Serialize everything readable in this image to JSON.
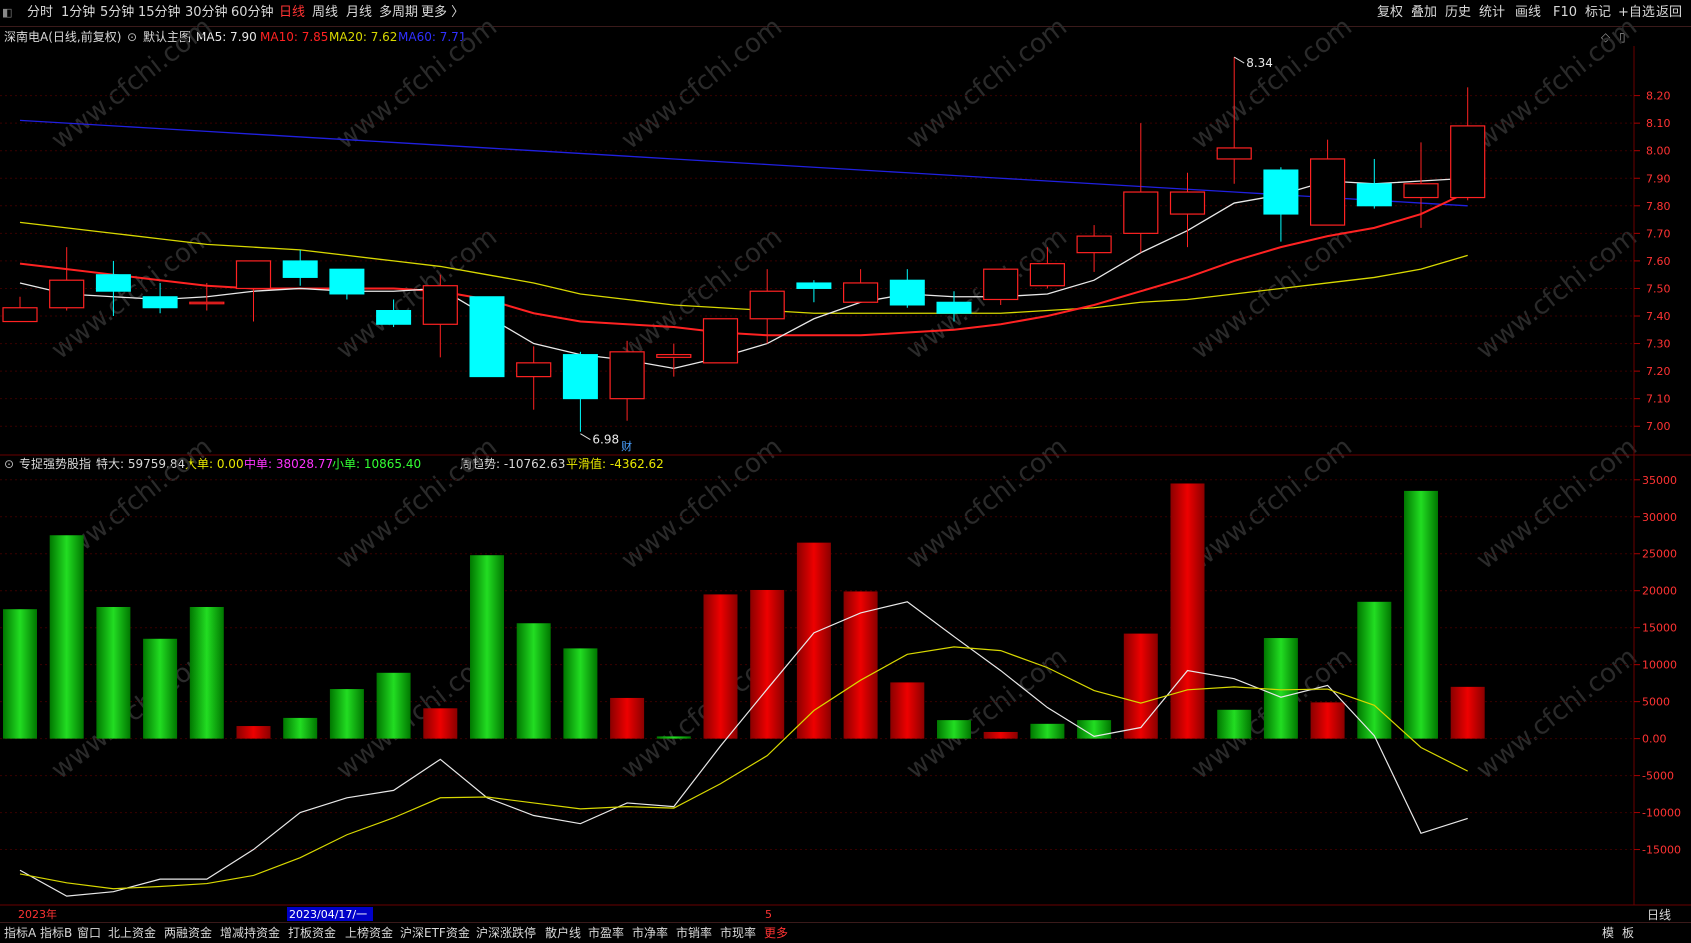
{
  "toolbar": {
    "periods": [
      "分时",
      "1分钟",
      "5分钟",
      "15分钟",
      "30分钟",
      "60分钟",
      "日线",
      "周线",
      "月线",
      "多周期",
      "更多 〉"
    ],
    "active_period": "日线",
    "tools": [
      "复权",
      "叠加",
      "历史",
      "统计",
      "画线",
      "F10",
      "标记",
      "+自选",
      "返回"
    ]
  },
  "main_header": {
    "stock": "深南电A(日线,前复权)",
    "main_label": "默认主图",
    "ma5": "MA5: 7.90",
    "ma10": "MA10: 7.85",
    "ma20": "MA20: 7.62",
    "ma60": "MA60: 7.71"
  },
  "indicator_header": {
    "name": "专捉强势股指",
    "tedai": "特大: 59759.84",
    "dadan": "大单: 0.00",
    "zhongdan": "中单: 38028.77",
    "xiaodan": "小单: 10865.40",
    "zhouqushi": "周趋势: -10762.63",
    "pinghua": "平滑值: -4362.62"
  },
  "axis_footer": {
    "year": "2023年",
    "cursor_date": "2023/04/17/一",
    "month_mark": "5",
    "period_label": "日线"
  },
  "bottom_tabs": [
    "指标A",
    "指标B",
    "窗口",
    "北上资金",
    "两融资金",
    "增减持资金",
    "打板资金",
    "上榜资金",
    "沪深ETF资金",
    "沪深涨跌停",
    "散户线",
    "市盈率",
    "市净率",
    "市销率",
    "市现率",
    "更多"
  ],
  "bottom_right": [
    "模",
    "板"
  ],
  "colors": {
    "up": "#ff2222",
    "down": "#00ffff",
    "ma5": "#e8e8e8",
    "ma10": "#ff2222",
    "ma20": "#d8d800",
    "ma60": "#2020e0",
    "bar_up": "#dd0000",
    "bar_down": "#00bb00"
  },
  "watermark": "www.cfchi.com",
  "chart_data": [
    {
      "type": "candlestick",
      "ylim": [
        6.95,
        8.38
      ],
      "y_ticks": [
        7.0,
        7.1,
        7.2,
        7.3,
        7.4,
        7.5,
        7.6,
        7.7,
        7.8,
        7.9,
        8.0,
        8.1,
        8.2
      ],
      "candles": [
        {
          "o": 7.38,
          "h": 7.47,
          "l": 7.38,
          "c": 7.43
        },
        {
          "o": 7.43,
          "h": 7.65,
          "l": 7.42,
          "c": 7.53
        },
        {
          "o": 7.55,
          "h": 7.6,
          "l": 7.4,
          "c": 7.49
        },
        {
          "o": 7.47,
          "h": 7.52,
          "l": 7.41,
          "c": 7.43
        },
        {
          "o": 7.45,
          "h": 7.52,
          "l": 7.42,
          "c": 7.45
        },
        {
          "o": 7.5,
          "h": 7.6,
          "l": 7.38,
          "c": 7.6
        },
        {
          "o": 7.6,
          "h": 7.64,
          "l": 7.51,
          "c": 7.54
        },
        {
          "o": 7.57,
          "h": 7.57,
          "l": 7.46,
          "c": 7.48
        },
        {
          "o": 7.42,
          "h": 7.46,
          "l": 7.36,
          "c": 7.37
        },
        {
          "o": 7.37,
          "h": 7.55,
          "l": 7.25,
          "c": 7.51
        },
        {
          "o": 7.47,
          "h": 7.47,
          "l": 7.18,
          "c": 7.18
        },
        {
          "o": 7.18,
          "h": 7.29,
          "l": 7.06,
          "c": 7.23
        },
        {
          "o": 7.26,
          "h": 7.27,
          "l": 6.98,
          "c": 7.1
        },
        {
          "o": 7.1,
          "h": 7.31,
          "l": 7.02,
          "c": 7.27
        },
        {
          "o": 7.25,
          "h": 7.3,
          "l": 7.18,
          "c": 7.26
        },
        {
          "o": 7.23,
          "h": 7.39,
          "l": 7.23,
          "c": 7.39
        },
        {
          "o": 7.39,
          "h": 7.57,
          "l": 7.3,
          "c": 7.49
        },
        {
          "o": 7.52,
          "h": 7.53,
          "l": 7.45,
          "c": 7.5
        },
        {
          "o": 7.45,
          "h": 7.57,
          "l": 7.45,
          "c": 7.52
        },
        {
          "o": 7.53,
          "h": 7.57,
          "l": 7.43,
          "c": 7.44
        },
        {
          "o": 7.45,
          "h": 7.49,
          "l": 7.38,
          "c": 7.41
        },
        {
          "o": 7.46,
          "h": 7.57,
          "l": 7.44,
          "c": 7.57
        },
        {
          "o": 7.51,
          "h": 7.65,
          "l": 7.5,
          "c": 7.59
        },
        {
          "o": 7.63,
          "h": 7.73,
          "l": 7.56,
          "c": 7.69
        },
        {
          "o": 7.7,
          "h": 8.1,
          "l": 7.63,
          "c": 7.85
        },
        {
          "o": 7.77,
          "h": 7.92,
          "l": 7.65,
          "c": 7.85
        },
        {
          "o": 7.97,
          "h": 8.34,
          "l": 7.88,
          "c": 8.01
        },
        {
          "o": 7.93,
          "h": 7.94,
          "l": 7.67,
          "c": 7.77
        },
        {
          "o": 7.73,
          "h": 8.04,
          "l": 7.73,
          "c": 7.97
        },
        {
          "o": 7.88,
          "h": 7.97,
          "l": 7.79,
          "c": 7.8
        },
        {
          "o": 7.83,
          "h": 8.03,
          "l": 7.72,
          "c": 7.88
        },
        {
          "o": 7.83,
          "h": 8.23,
          "l": 7.82,
          "c": 8.09
        }
      ],
      "ma5": [
        7.52,
        7.48,
        7.47,
        7.46,
        7.47,
        7.49,
        7.5,
        7.49,
        7.49,
        7.5,
        7.4,
        7.3,
        7.26,
        7.24,
        7.21,
        7.25,
        7.3,
        7.39,
        7.45,
        7.48,
        7.47,
        7.47,
        7.48,
        7.53,
        7.63,
        7.71,
        7.81,
        7.84,
        7.89,
        7.88,
        7.89,
        7.9
      ],
      "ma10": [
        7.59,
        7.57,
        7.55,
        7.53,
        7.51,
        7.5,
        7.5,
        7.5,
        7.5,
        7.49,
        7.46,
        7.41,
        7.38,
        7.37,
        7.36,
        7.34,
        7.33,
        7.33,
        7.33,
        7.34,
        7.35,
        7.37,
        7.4,
        7.44,
        7.49,
        7.54,
        7.6,
        7.65,
        7.69,
        7.72,
        7.77,
        7.85
      ],
      "ma20": [
        7.74,
        7.72,
        7.7,
        7.68,
        7.66,
        7.65,
        7.64,
        7.62,
        7.6,
        7.58,
        7.55,
        7.52,
        7.48,
        7.46,
        7.44,
        7.43,
        7.42,
        7.41,
        7.41,
        7.41,
        7.41,
        7.41,
        7.42,
        7.43,
        7.45,
        7.46,
        7.48,
        7.5,
        7.52,
        7.54,
        7.57,
        7.62
      ],
      "ma60": [
        8.11,
        8.1,
        8.09,
        8.08,
        8.07,
        8.06,
        8.05,
        8.04,
        8.03,
        8.02,
        8.01,
        8.0,
        7.99,
        7.98,
        7.97,
        7.96,
        7.95,
        7.94,
        7.93,
        7.92,
        7.91,
        7.9,
        7.89,
        7.88,
        7.87,
        7.86,
        7.85,
        7.84,
        7.83,
        7.82,
        7.81,
        7.8
      ],
      "annotations": [
        {
          "label": "8.34",
          "index": 26,
          "value": 8.34
        },
        {
          "label": "6.98",
          "index": 12,
          "value": 6.98
        },
        {
          "label": "财",
          "index": 13,
          "value": 6.98
        }
      ]
    },
    {
      "type": "bar",
      "ylim": [
        -22500,
        37000
      ],
      "y_ticks": [
        35000,
        30000,
        25000,
        20000,
        15000,
        10000,
        5000,
        0,
        -5000,
        -10000,
        -15000
      ],
      "y_tick_labels": [
        "35000",
        "30000",
        "25000",
        "20000",
        "15000",
        "10000",
        "5000",
        "0.00",
        "-5000",
        "-10000",
        "-15000"
      ],
      "bars": [
        17500,
        27500,
        17800,
        13500,
        17800,
        1700,
        2800,
        6700,
        8900,
        4100,
        24800,
        15600,
        12200,
        5500,
        300,
        19500,
        20100,
        26500,
        19900,
        7600,
        2500,
        900,
        2000,
        2500,
        14200,
        34500,
        3900,
        13600,
        4900,
        18500,
        33500,
        7000
      ],
      "bar_colors": [
        "down",
        "down",
        "down",
        "down",
        "down",
        "up",
        "down",
        "down",
        "down",
        "up",
        "down",
        "down",
        "down",
        "up",
        "down",
        "up",
        "up",
        "up",
        "up",
        "up",
        "down",
        "up",
        "down",
        "down",
        "up",
        "up",
        "down",
        "down",
        "up",
        "down",
        "down",
        "up"
      ],
      "series": [
        {
          "name": "周趋势",
          "color": "#e8e8e8",
          "values": [
            -17800,
            -21300,
            -20700,
            -19000,
            -19000,
            -15000,
            -10000,
            -8000,
            -7000,
            -2800,
            -8000,
            -10400,
            -11500,
            -8700,
            -9200,
            -1000,
            6700,
            14300,
            17000,
            18500,
            13800,
            9200,
            4200,
            300,
            1500,
            9200,
            8100,
            5600,
            7200,
            400,
            -12800,
            -10800
          ]
        },
        {
          "name": "平滑值",
          "color": "#d8d800",
          "values": [
            -18300,
            -19500,
            -20300,
            -20000,
            -19600,
            -18500,
            -16100,
            -13000,
            -10700,
            -8000,
            -7900,
            -8700,
            -9500,
            -9200,
            -9400,
            -6100,
            -2300,
            3800,
            7900,
            11400,
            12400,
            11900,
            9600,
            6500,
            4800,
            6600,
            7000,
            6600,
            6700,
            4500,
            -1200,
            -4400
          ]
        }
      ]
    }
  ]
}
